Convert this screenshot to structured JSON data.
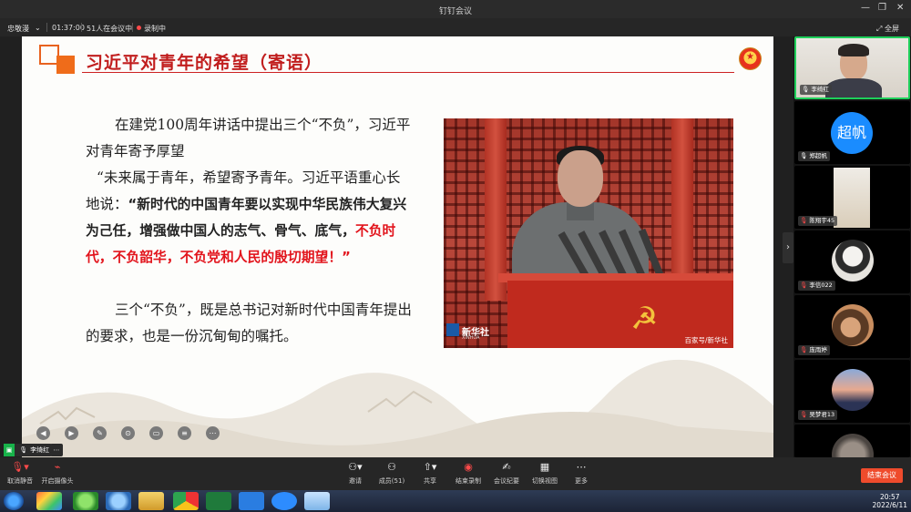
{
  "window": {
    "title": "钉钉会议"
  },
  "infobar": {
    "speaker": "忠敬漫",
    "duration": "01:37:00",
    "participants": "51人在会议中",
    "recording": "录制中",
    "fullscreen": "全屏"
  },
  "slide": {
    "heading": "习近平对青年的希望（寄语）",
    "p1": "在建党100周年讲话中提出三个“不负”，习近平对青年寄予厚望",
    "p2_plain": "“未来属于青年，希望寄予青年。习近平语重心长地说：",
    "p2_bold": "“新时代的中国青年要以实现中华民族伟大复兴为己任，增强做中国人的志气、骨气、底气，",
    "p2_red": "不负时代，不负韶华，不负党和人民的殷切期望！",
    "p2_end": "”",
    "p3": "三个“不负”，既是总书记对新时代中国青年提出的要求，也是一份沉甸甸的嘱托。",
    "photo": {
      "logo": "新华社",
      "logo_sub": "XINHUA",
      "credit": "百家号/新华社"
    }
  },
  "self_view": {
    "name": "李绮红"
  },
  "participants": [
    {
      "name": "李绮红",
      "type": "video",
      "active": true
    },
    {
      "name": "郑超帆",
      "type": "text",
      "avatar_text": "超帆",
      "active": false
    },
    {
      "name": "陈翔宇45",
      "type": "image",
      "active": false
    },
    {
      "name": "李信022",
      "type": "image",
      "active": false
    },
    {
      "name": "庞雨婷",
      "type": "image",
      "active": false
    },
    {
      "name": "吴梦君13",
      "type": "image",
      "active": false
    },
    {
      "name": "",
      "type": "image",
      "active": false
    }
  ],
  "toolbar": {
    "mute": "取消静音",
    "camera": "开启摄像头",
    "manage": "邀请",
    "members": "成员(51)",
    "share": "共享",
    "record": "结束录制",
    "minutes": "会议纪要",
    "layout": "切换视图",
    "more": "更多",
    "end": "结束会议"
  },
  "taskbar": {
    "time": "20:57",
    "date": "2022/6/11"
  },
  "colors": {
    "accent_red": "#c11e1e",
    "orange": "#ef6c1a",
    "active_green": "#1ecf5a",
    "end_button": "#ef4b2c",
    "avatar_blue": "#1a8cff"
  }
}
